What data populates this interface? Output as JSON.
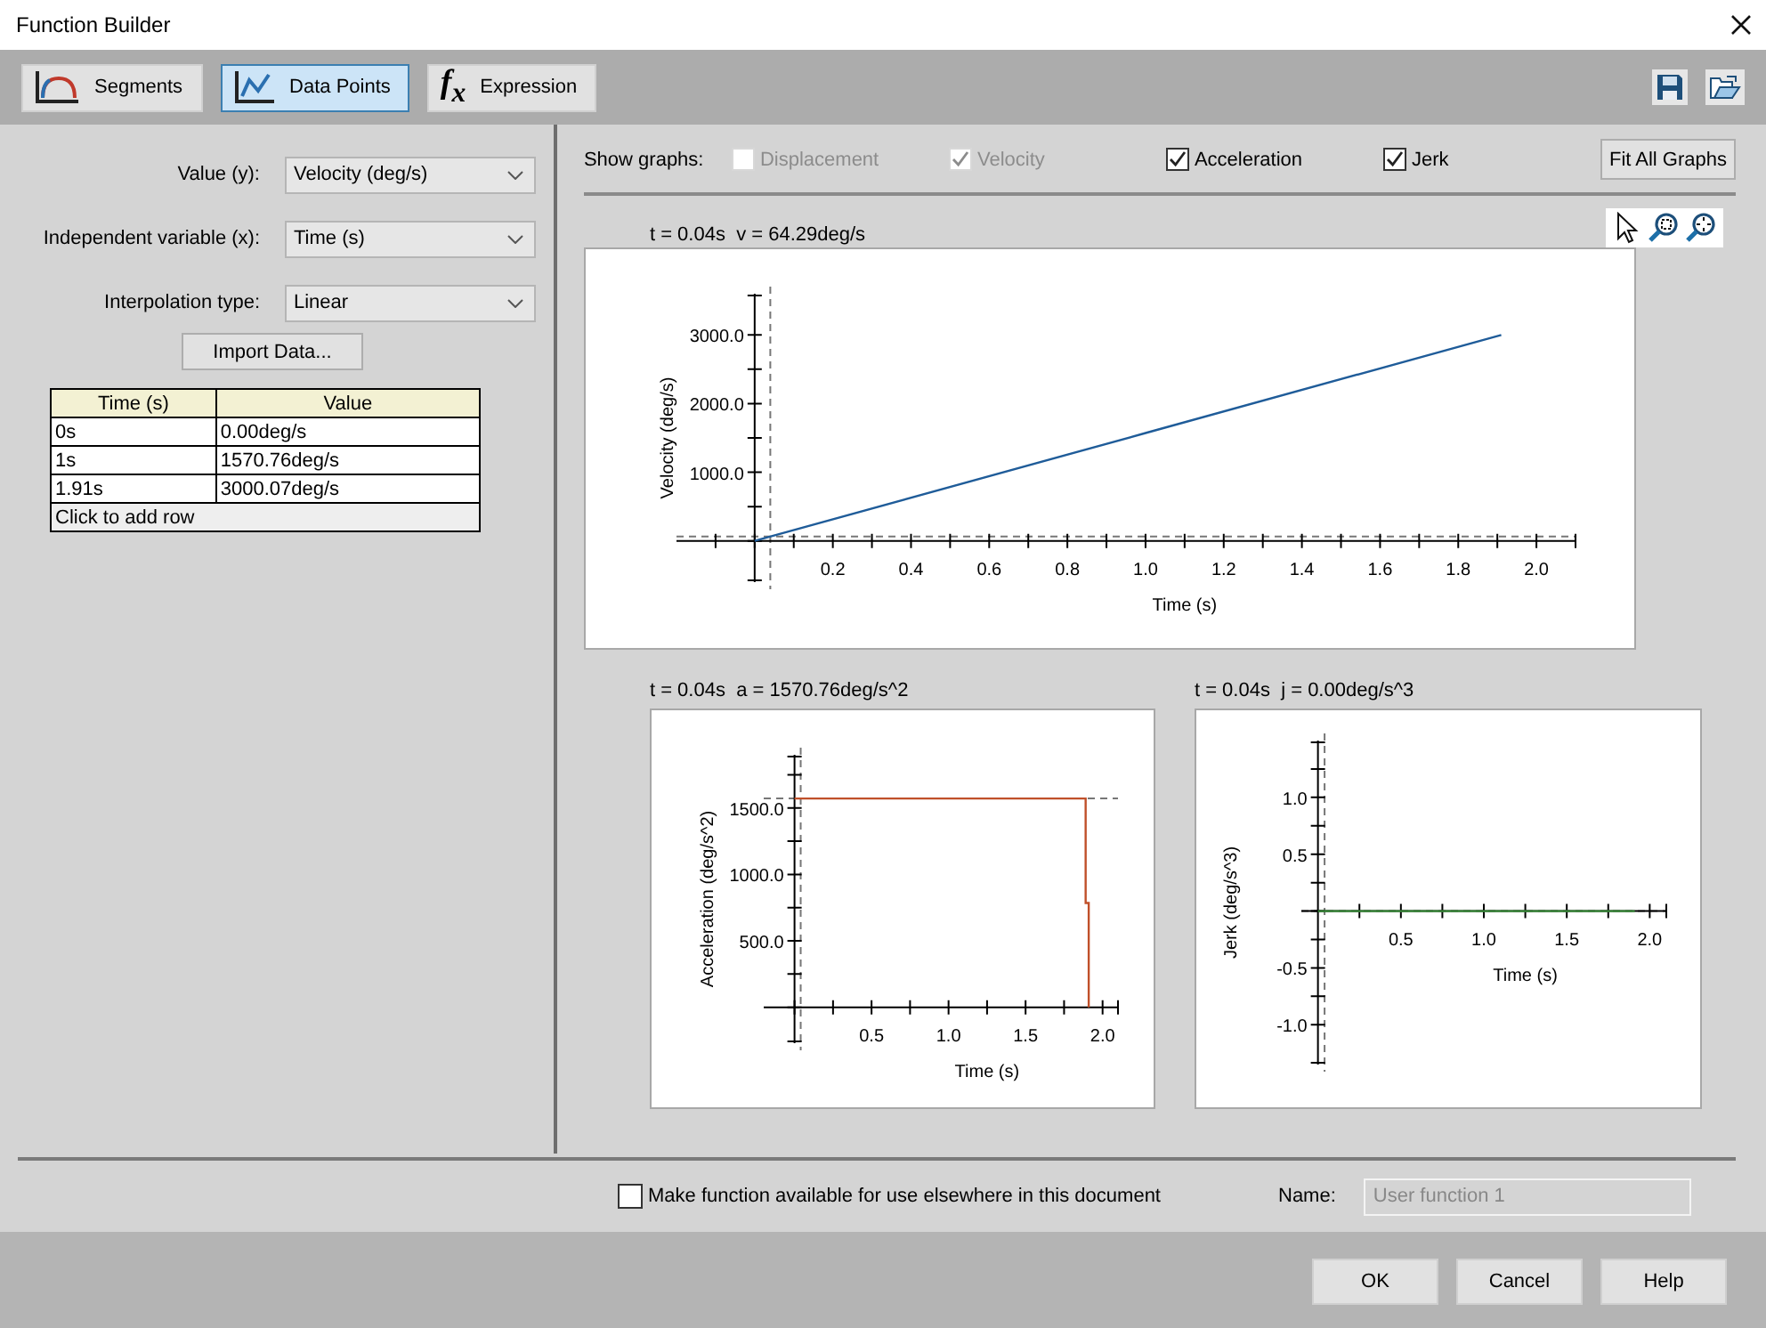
{
  "window": {
    "title": "Function Builder"
  },
  "mode_tabs": [
    {
      "label": "Segments",
      "kind": "segments",
      "selected": false
    },
    {
      "label": "Data Points",
      "kind": "points",
      "selected": true
    },
    {
      "label": "Expression",
      "kind": "expression",
      "glyph": "f$_{x}$",
      "selected": false
    }
  ],
  "left_panel": {
    "fields": [
      {
        "label": "Value (y):",
        "value": "Velocity (deg/s)"
      },
      {
        "label": "Independent variable (x):",
        "value": "Time (s)"
      },
      {
        "label": "Interpolation type:",
        "value": "Linear"
      }
    ],
    "import_button": "Import Data...",
    "table": {
      "columns": [
        "Time (s)",
        "Value"
      ],
      "rows": [
        [
          "0s",
          "0.00deg/s"
        ],
        [
          "1s",
          "1570.76deg/s"
        ],
        [
          "1.91s",
          "3000.07deg/s"
        ]
      ],
      "add_row": "Click to add row"
    }
  },
  "graphs_bar": {
    "label": "Show graphs:",
    "options": [
      {
        "label": "Displacement",
        "checked": false,
        "disabled": true
      },
      {
        "label": "Velocity",
        "checked": true,
        "disabled": true
      },
      {
        "label": "Acceleration",
        "checked": true,
        "disabled": false
      },
      {
        "label": "Jerk",
        "checked": true,
        "disabled": false
      }
    ],
    "fit_button": "Fit All Graphs"
  },
  "graphs": [
    {
      "readout": "t = 0.04s  v = 64.29deg/s",
      "chart_data": {
        "type": "line",
        "xlabel": "Time (s)",
        "ylabel": "Velocity (deg/s)",
        "x": [
          0,
          1,
          1.91
        ],
        "series": [
          {
            "color": "#1f5c99",
            "values": [
              0,
              1571,
              3000
            ]
          }
        ],
        "xlim": [
          -0.2,
          2.1
        ],
        "ylim": [
          -600,
          3600
        ],
        "xticks": [
          {
            "value": 0.2,
            "label": "0.2"
          },
          {
            "value": 0.4,
            "label": "0.4"
          },
          {
            "value": 0.6,
            "label": "0.6"
          },
          {
            "value": 0.8,
            "label": "0.8"
          },
          {
            "value": 1,
            "label": "1.0"
          },
          {
            "value": 1.2,
            "label": "1.2"
          },
          {
            "value": 1.4,
            "label": "1.4"
          },
          {
            "value": 1.6,
            "label": "1.6"
          },
          {
            "value": 1.8,
            "label": "1.8"
          },
          {
            "value": 2,
            "label": "2.0"
          }
        ],
        "yticks": [
          {
            "value": 1000,
            "label": "1000.0"
          },
          {
            "value": 2000,
            "label": "2000.0"
          },
          {
            "value": 3000,
            "label": "3000.0"
          }
        ],
        "ref_lines": [
          {
            "axis": "x",
            "value": 0.04
          },
          {
            "axis": "y",
            "value": 64
          }
        ]
      }
    },
    {
      "readout": "t = 0.04s  a = 1570.76deg/s^2",
      "chart_data": {
        "type": "line",
        "xlabel": "Time (s)",
        "ylabel": "Acceleration (deg/s^2)",
        "x": [
          0,
          1.89,
          1.89,
          1.91,
          1.91
        ],
        "series": [
          {
            "color": "#c0502a",
            "values": [
              1571,
              1571,
              785,
              785,
              0
            ]
          }
        ],
        "xlim": [
          -0.2,
          2.1
        ],
        "ylim": [
          -270,
          1900
        ],
        "xticks": [
          {
            "value": 0.5,
            "label": "0.5"
          },
          {
            "value": 1,
            "label": "1.0"
          },
          {
            "value": 1.5,
            "label": "1.5"
          },
          {
            "value": 2,
            "label": "2.0"
          }
        ],
        "yticks": [
          {
            "value": 500,
            "label": "500.0"
          },
          {
            "value": 1000,
            "label": "1000.0"
          },
          {
            "value": 1500,
            "label": "1500.0"
          }
        ],
        "ref_lines": [
          {
            "axis": "x",
            "value": 0.04
          },
          {
            "axis": "y",
            "value": 1571
          }
        ]
      }
    },
    {
      "readout": "t = 0.04s  j = 0.00deg/s^3",
      "chart_data": {
        "type": "line",
        "xlabel": "Time (s)",
        "ylabel": "Jerk (deg/s^3)",
        "x": [
          0,
          1.91
        ],
        "series": [
          {
            "color": "#3a8a3a",
            "values": [
              0,
              0
            ]
          }
        ],
        "xlim": [
          -0.1,
          2.1
        ],
        "ylim": [
          -1.35,
          1.5
        ],
        "xticks": [
          {
            "value": 0.5,
            "label": "0.5"
          },
          {
            "value": 1,
            "label": "1.0"
          },
          {
            "value": 1.5,
            "label": "1.5"
          },
          {
            "value": 2,
            "label": "2.0"
          }
        ],
        "yticks": [
          {
            "value": -1,
            "label": "-1.0"
          },
          {
            "value": -0.5,
            "label": "-0.5"
          },
          {
            "value": 0.5,
            "label": "0.5"
          },
          {
            "value": 1,
            "label": "1.0"
          }
        ],
        "ref_lines": [
          {
            "axis": "x",
            "value": 0.04
          },
          {
            "axis": "y",
            "value": 0
          }
        ]
      }
    }
  ],
  "footer": {
    "share_label": "Make function available for use elsewhere in this document",
    "share_checked": false,
    "name_label": "Name:",
    "name_value": "User function 1",
    "name_disabled": true
  },
  "buttons": [
    "OK",
    "Cancel",
    "Help"
  ]
}
